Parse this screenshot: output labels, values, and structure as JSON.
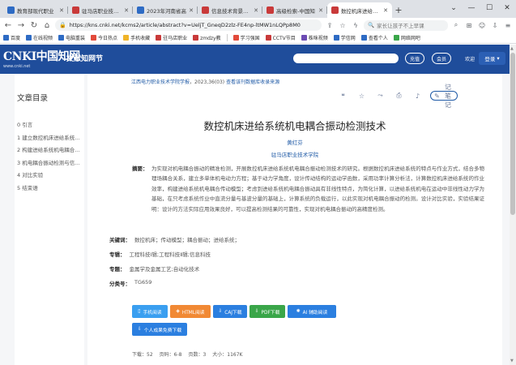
{
  "browser": {
    "tabs": [
      {
        "label": "教育部现代职业",
        "fav": "#2e6bc4",
        "active": false
      },
      {
        "label": "驻马店职业技术学",
        "fav": "#c93a3a",
        "active": false
      },
      {
        "label": "2023年河南省高",
        "fav": "#2e6bc4",
        "active": false
      },
      {
        "label": "信息技术背景下社",
        "fav": "#c93a3a",
        "active": false
      },
      {
        "label": "高级检索-中国知",
        "fav": "#c93a3a",
        "active": false
      },
      {
        "label": "数控机床进给系统",
        "fav": "#c93a3a",
        "active": true
      }
    ],
    "url": "https://kns.cnki.net/kcms2/article/abstract?v=UeljT_GneqD2zlz-FE4np-ltMW1nLQPp8M0",
    "side_search": "家长让孩子不上早课",
    "bookmarks": [
      "百度",
      "在线视频",
      "电脑重装",
      "今日热点",
      "手机收藏",
      "驻马店职业",
      "zmdzy教",
      "学习强国",
      "CCTV节目",
      "株咪视频",
      "学信网",
      "查看个人",
      "网络网吧"
    ]
  },
  "header": {
    "logo_text": "CNKI中国知网",
    "logo_url": "www.cnki.net",
    "brand": "文献知网节",
    "btn1": "充值",
    "btn2": "会员",
    "welcome": "欢迎",
    "login": "登录"
  },
  "toc": {
    "title": "文章目录",
    "items": [
      "0 引言",
      "1 建立数控机床进给系统...",
      "2 构建进给系统机电耦合...",
      "3 机电耦合振动检测与信...",
      "4 对比实验",
      "5 结束语"
    ]
  },
  "article": {
    "source": "江西电力职业技术学院学报",
    "source_meta": "，2023,36(03)",
    "source_link": "查看该刊数据库收录来源",
    "note_btn": "记笔记",
    "title": "数控机床进给系统机电耦合振动检测技术",
    "author": "黄红芬",
    "org": "驻马店职业技术学院",
    "abstract_label": "摘要：",
    "abstract": "为实现对机电耦合振动的精准检测，开展数控机床进给系统机电耦合振动检测技术的研究。根据数控机床进给系统的特点与作业方式，结合多物理场耦合关系，建立多单体机电动力方程；基于动力学角度，设计传动结构的运动学函数，采用功率计算分析法，计算数控机床进给系统的作业效率，构建进给系统机电耦合传动模型；考虑到进给系统机电耦合振动具有非线性特点，为简化计算，以进给系统机电在运动中非线性动力学为基础，在只考虑系统作业中直流分量与基波分量的基础上，计算系统的负载运行，以此实现对机电耦合振动的检测。设计对比实验，实验结果证明：设计的方法实际应用效果良好，可以提高检测结果的可靠性，实现对机电耦合振动的高精度检测。",
    "keywords_label": "关键词：",
    "keywords": "数控机床；传动模型；耦合振动；进给系统；",
    "subject_label": "专辑：",
    "subject": "工程科技Ⅰ辑;工程科技Ⅱ辑;信息科技",
    "topic_label": "专题：",
    "topic": "金属学及金属工艺;自动化技术",
    "class_label": "分类号：",
    "class": "TG659",
    "buttons": [
      "手机阅读",
      "HTML阅读",
      "CAJ下载",
      "PDF下载",
      "AI 辅助阅读"
    ],
    "button_personal": "个人成果免费下载",
    "stats": {
      "downloads": "下载：52",
      "pages": "页码：6-8",
      "page_count": "页数：3",
      "size": "大小：1167K"
    }
  }
}
